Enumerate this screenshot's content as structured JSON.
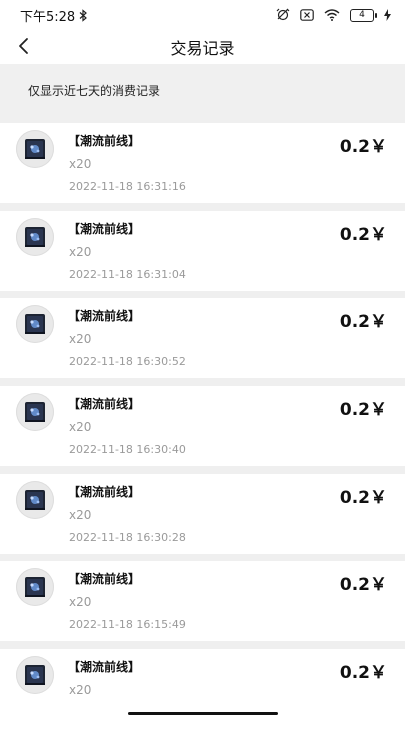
{
  "status_bar": {
    "time": "下午5:28",
    "battery": "4"
  },
  "header": {
    "title": "交易记录"
  },
  "notice": "仅显示近七天的消费记录",
  "records": [
    {
      "name": "【潮流前线】",
      "qty": "x20",
      "time": "2022-11-18 16:31:16",
      "price": "0.2￥"
    },
    {
      "name": "【潮流前线】",
      "qty": "x20",
      "time": "2022-11-18 16:31:04",
      "price": "0.2￥"
    },
    {
      "name": "【潮流前线】",
      "qty": "x20",
      "time": "2022-11-18 16:30:52",
      "price": "0.2￥"
    },
    {
      "name": "【潮流前线】",
      "qty": "x20",
      "time": "2022-11-18 16:30:40",
      "price": "0.2￥"
    },
    {
      "name": "【潮流前线】",
      "qty": "x20",
      "time": "2022-11-18 16:30:28",
      "price": "0.2￥"
    },
    {
      "name": "【潮流前线】",
      "qty": "x20",
      "time": "2022-11-18 16:15:49",
      "price": "0.2￥"
    },
    {
      "name": "【潮流前线】",
      "qty": "x20",
      "time": "",
      "price": "0.2￥"
    }
  ]
}
